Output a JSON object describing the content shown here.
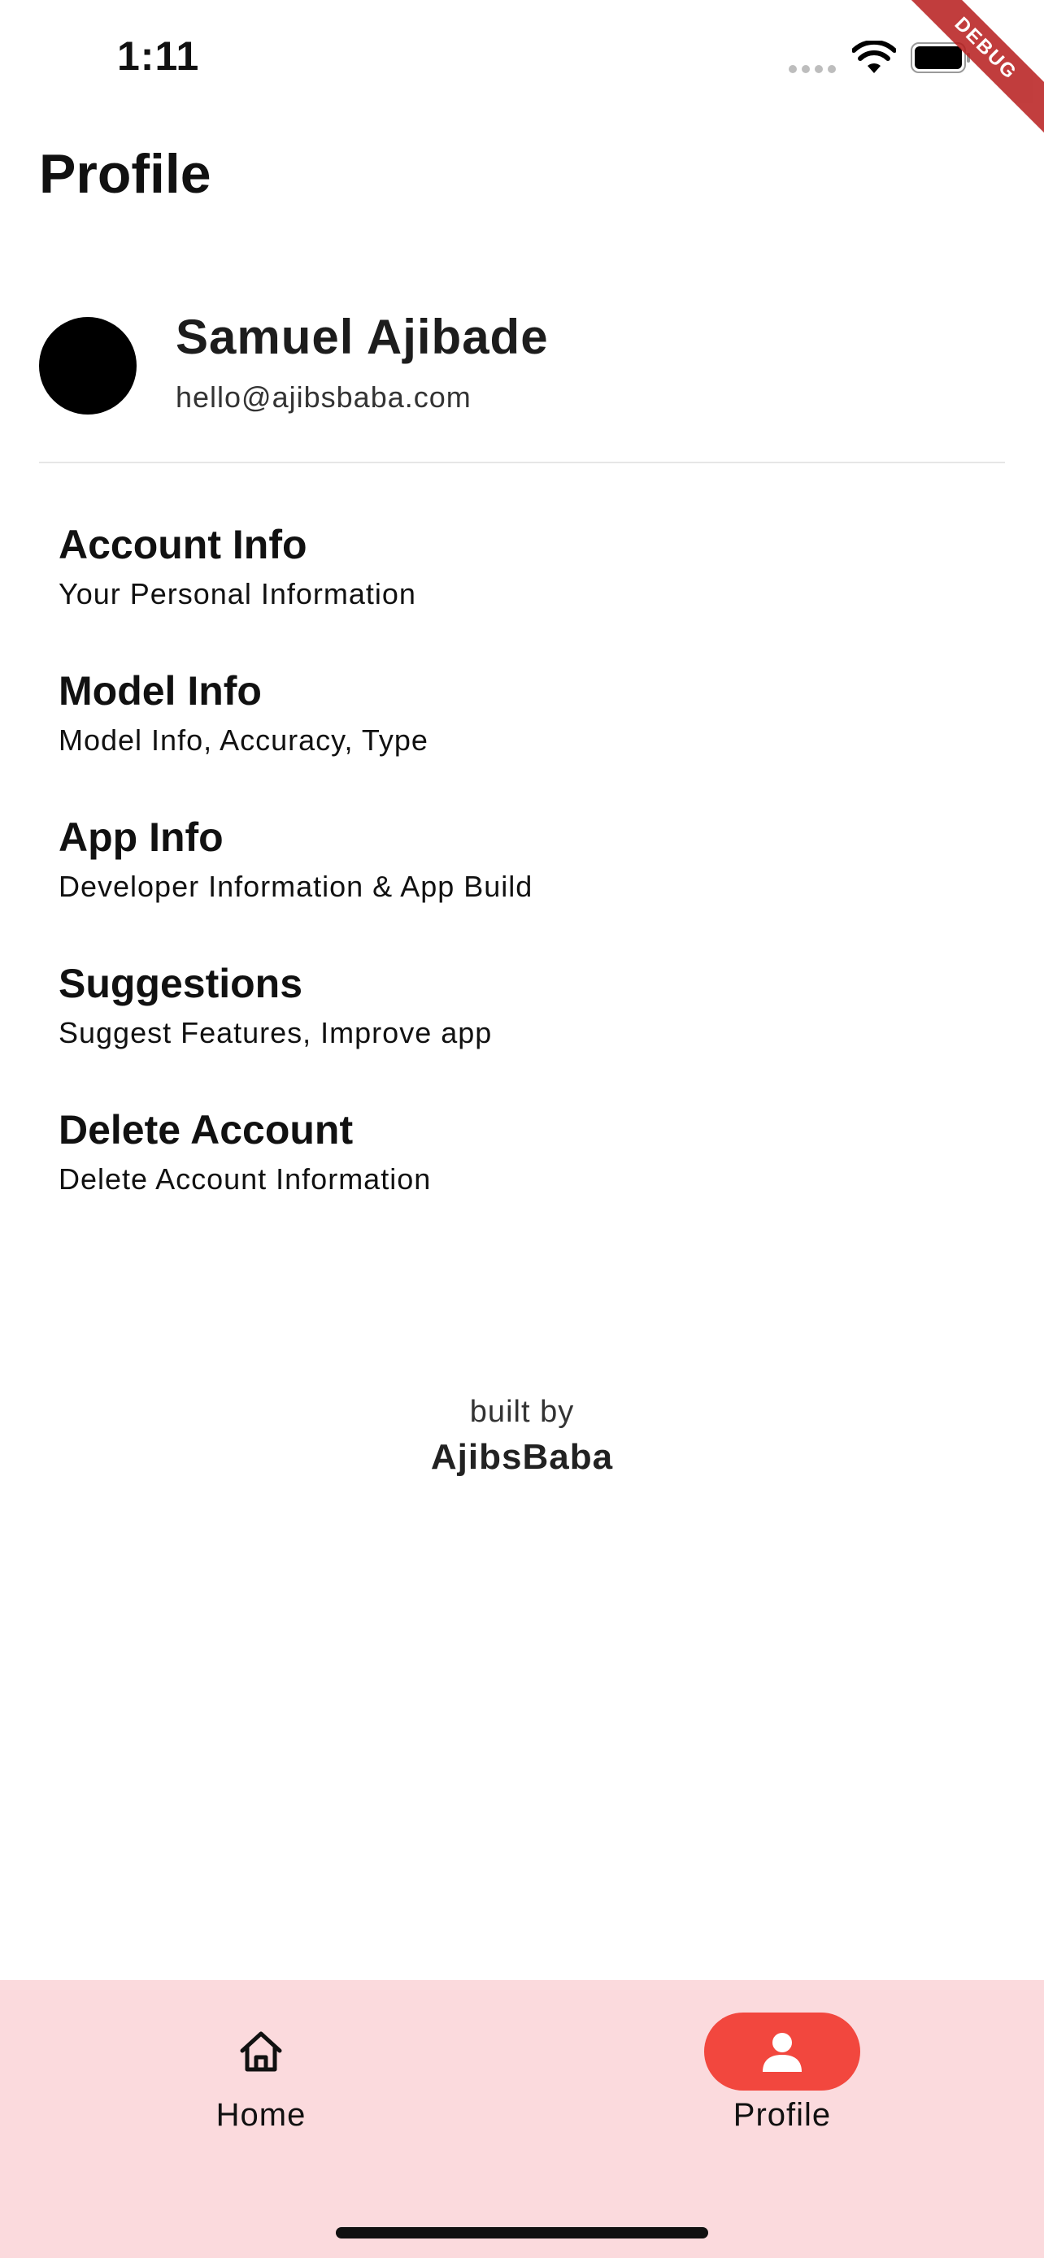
{
  "status_bar": {
    "time": "1:11",
    "debug_label": "DEBUG"
  },
  "header": {
    "title": "Profile"
  },
  "user": {
    "name": "Samuel Ajibade",
    "email": "hello@ajibsbaba.com"
  },
  "menu": {
    "items": [
      {
        "title": "Account Info",
        "subtitle": "Your Personal Information"
      },
      {
        "title": "Model Info",
        "subtitle": "Model Info, Accuracy, Type"
      },
      {
        "title": "App Info",
        "subtitle": "Developer Information & App Build"
      },
      {
        "title": "Suggestions",
        "subtitle": "Suggest Features, Improve app"
      },
      {
        "title": "Delete Account",
        "subtitle": "Delete Account Information"
      }
    ]
  },
  "footer": {
    "built_by": "built by",
    "author": "AjibsBaba"
  },
  "bottom_nav": {
    "items": [
      {
        "label": "Home",
        "icon": "home-icon",
        "active": false
      },
      {
        "label": "Profile",
        "icon": "person-icon",
        "active": true
      }
    ],
    "background": "#fbdadd",
    "active_color": "#f2473e"
  }
}
